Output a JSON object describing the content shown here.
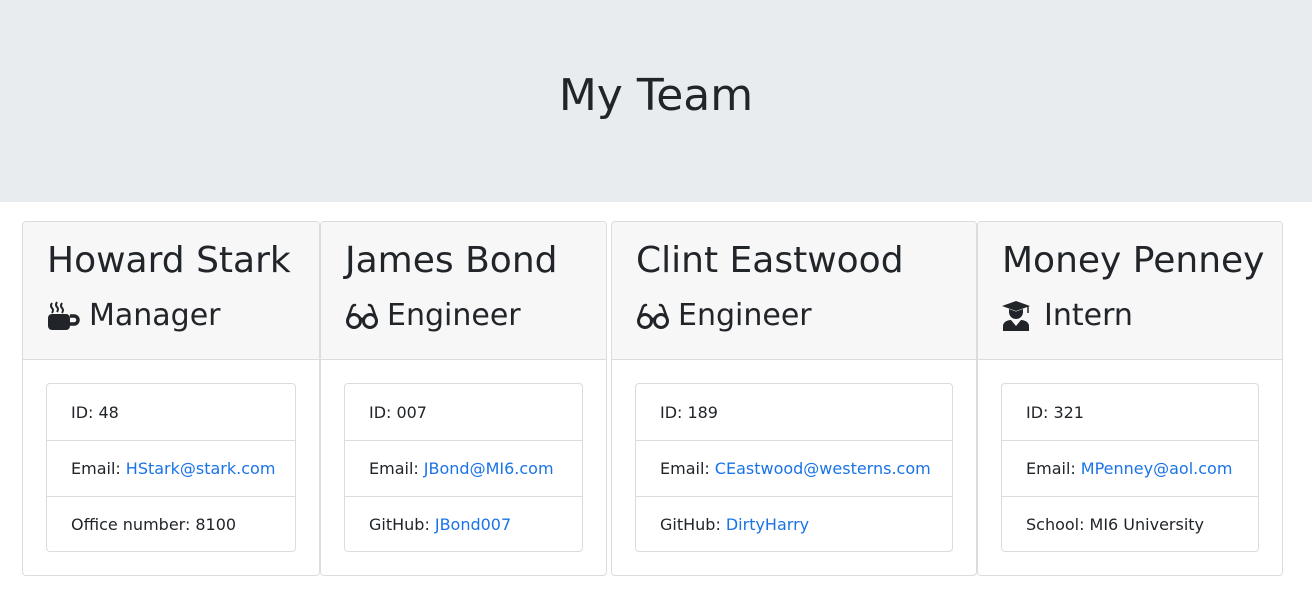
{
  "header": {
    "title": "My Team"
  },
  "cards": [
    {
      "name": "Howard Stark",
      "role": "Manager",
      "icon": "coffee-mug-icon",
      "id_label": "ID:",
      "id": "48",
      "email_label": "Email:",
      "email": "HStark@stark.com",
      "extra_label": "Office number:",
      "extra_value": "8100"
    },
    {
      "name": "James Bond",
      "role": "Engineer",
      "icon": "glasses-icon",
      "id_label": "ID:",
      "id": "007",
      "email_label": "Email:",
      "email": "JBond@MI6.com",
      "extra_label": "GitHub:",
      "extra_value": "JBond007"
    },
    {
      "name": "Clint Eastwood",
      "role": "Engineer",
      "icon": "glasses-icon",
      "id_label": "ID:",
      "id": "189",
      "email_label": "Email:",
      "email": "CEastwood@westerns.com",
      "extra_label": "GitHub:",
      "extra_value": "DirtyHarry"
    },
    {
      "name": "Money Penney",
      "role": "Intern",
      "icon": "graduate-icon",
      "id_label": "ID:",
      "id": "321",
      "email_label": "Email:",
      "email": "MPenney@aol.com",
      "extra_label": "School:",
      "extra_value": "MI6 University"
    }
  ],
  "colors": {
    "jumbotron_bg": "#e9ecef",
    "card_header_bg": "#f7f7f7",
    "link": "#1a73e8",
    "text": "#212529"
  }
}
